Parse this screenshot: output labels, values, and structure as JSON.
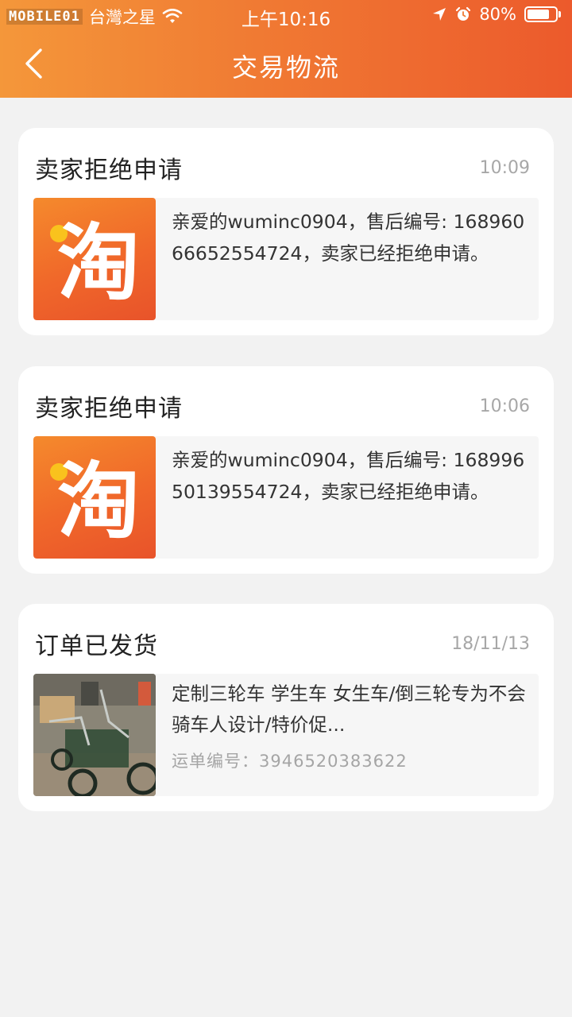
{
  "status_bar": {
    "watermark": "MOBILE01",
    "carrier": "台灣之星",
    "time": "上午10:16",
    "battery_percent": "80%",
    "battery_level": 0.8,
    "icons": [
      "wifi-icon",
      "location-icon",
      "alarm-icon",
      "battery-icon"
    ]
  },
  "nav": {
    "back_icon": "chevron-left-icon",
    "title": "交易物流"
  },
  "theme": {
    "header_gradient": [
      "#f4973a",
      "#ec5a2c"
    ],
    "background": "#f2f2f2"
  },
  "messages": [
    {
      "title": "卖家拒绝申请",
      "time": "10:09",
      "thumb": "taobao-logo",
      "thumb_text": "淘",
      "text": "亲爱的wuminc0904，售后编号: 16896066652554724，卖家已经拒绝申请。"
    },
    {
      "title": "卖家拒绝申请",
      "time": "10:06",
      "thumb": "taobao-logo",
      "thumb_text": "淘",
      "text": "亲爱的wuminc0904，售后编号: 16899650139554724，卖家已经拒绝申请。"
    },
    {
      "title": "订单已发货",
      "time": "18/11/13",
      "thumb": "tricycle-photo",
      "product": "定制三轮车 学生车 女生车/倒三轮专为不会骑车人设计/特价促...",
      "waybill": "运单编号：3946520383622"
    }
  ]
}
